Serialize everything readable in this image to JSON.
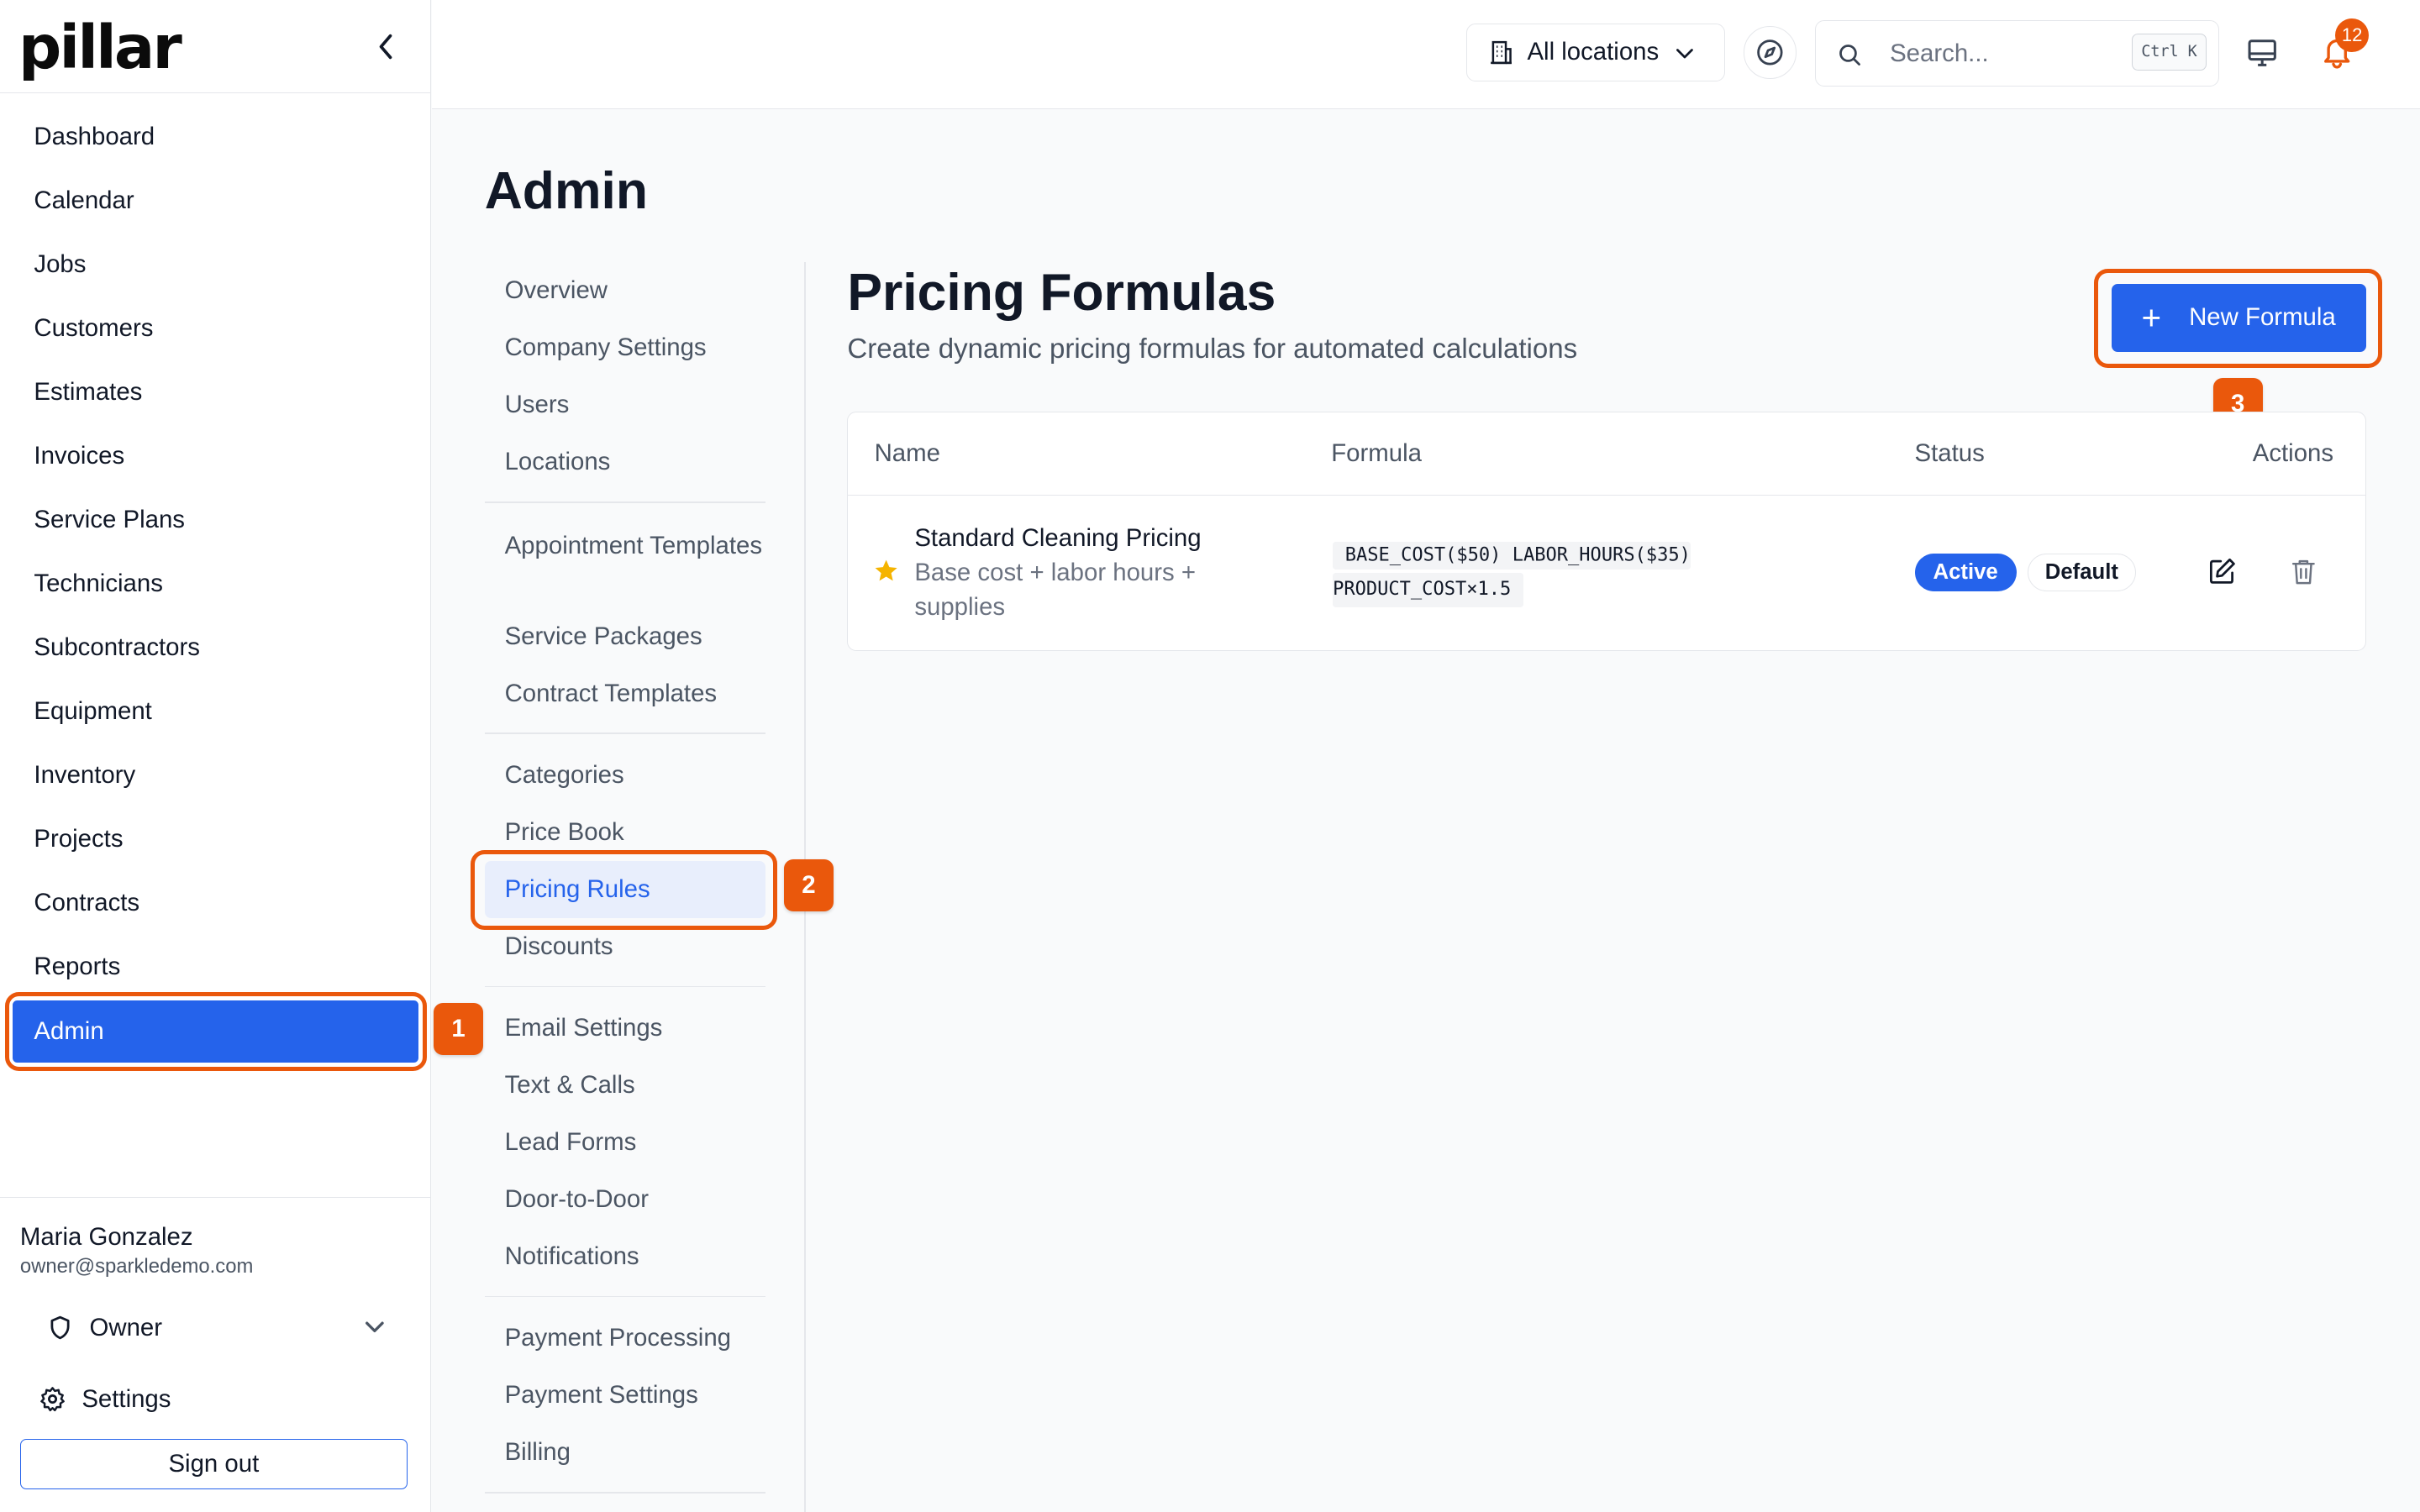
{
  "brand": {
    "logo_text": "pillar"
  },
  "sidebar": {
    "items": [
      {
        "label": "Dashboard"
      },
      {
        "label": "Calendar"
      },
      {
        "label": "Jobs"
      },
      {
        "label": "Customers"
      },
      {
        "label": "Estimates"
      },
      {
        "label": "Invoices"
      },
      {
        "label": "Service Plans"
      },
      {
        "label": "Technicians"
      },
      {
        "label": "Subcontractors"
      },
      {
        "label": "Equipment"
      },
      {
        "label": "Inventory"
      },
      {
        "label": "Projects"
      },
      {
        "label": "Contracts"
      },
      {
        "label": "Reports"
      },
      {
        "label": "Admin",
        "active": true
      }
    ],
    "user": {
      "name": "Maria Gonzalez",
      "email": "owner@sparkledemo.com",
      "role": "Owner",
      "settings_label": "Settings",
      "signout_label": "Sign out"
    }
  },
  "topbar": {
    "location_select": "All locations",
    "search_placeholder": "Search...",
    "search_shortcut": "Ctrl K",
    "notification_count": "12"
  },
  "page": {
    "title": "Admin"
  },
  "admin_nav": {
    "group1": [
      "Overview",
      "Company Settings",
      "Users",
      "Locations"
    ],
    "group2": [
      "Appointment Templates",
      "Service Packages",
      "Contract Templates"
    ],
    "group3": [
      "Categories",
      "Price Book",
      "Pricing Rules",
      "Discounts"
    ],
    "group4": [
      "Email Settings",
      "Text & Calls",
      "Lead Forms",
      "Door-to-Door",
      "Notifications"
    ],
    "group5": [
      "Payment Processing",
      "Payment Settings",
      "Billing"
    ],
    "active": "Pricing Rules"
  },
  "content": {
    "title": "Pricing Formulas",
    "subtitle": "Create dynamic pricing formulas for automated calculations",
    "new_button_label": "New Formula",
    "table": {
      "columns": [
        "Name",
        "Formula",
        "Status",
        "Actions"
      ],
      "rows": [
        {
          "name": "Standard Cleaning Pricing",
          "description": "Base cost + labor hours + supplies",
          "formula_line1": "BASE_COST($50) LABOR_HOURS($35)",
          "formula_line2": "PRODUCT_COST×1.5",
          "status": "Active",
          "tag": "Default"
        }
      ]
    }
  },
  "annotations": {
    "step1": "1",
    "step2": "2",
    "step3": "3"
  },
  "colors": {
    "accent": "#2563eb",
    "highlight": "#ea580c",
    "star": "#f5b400"
  }
}
